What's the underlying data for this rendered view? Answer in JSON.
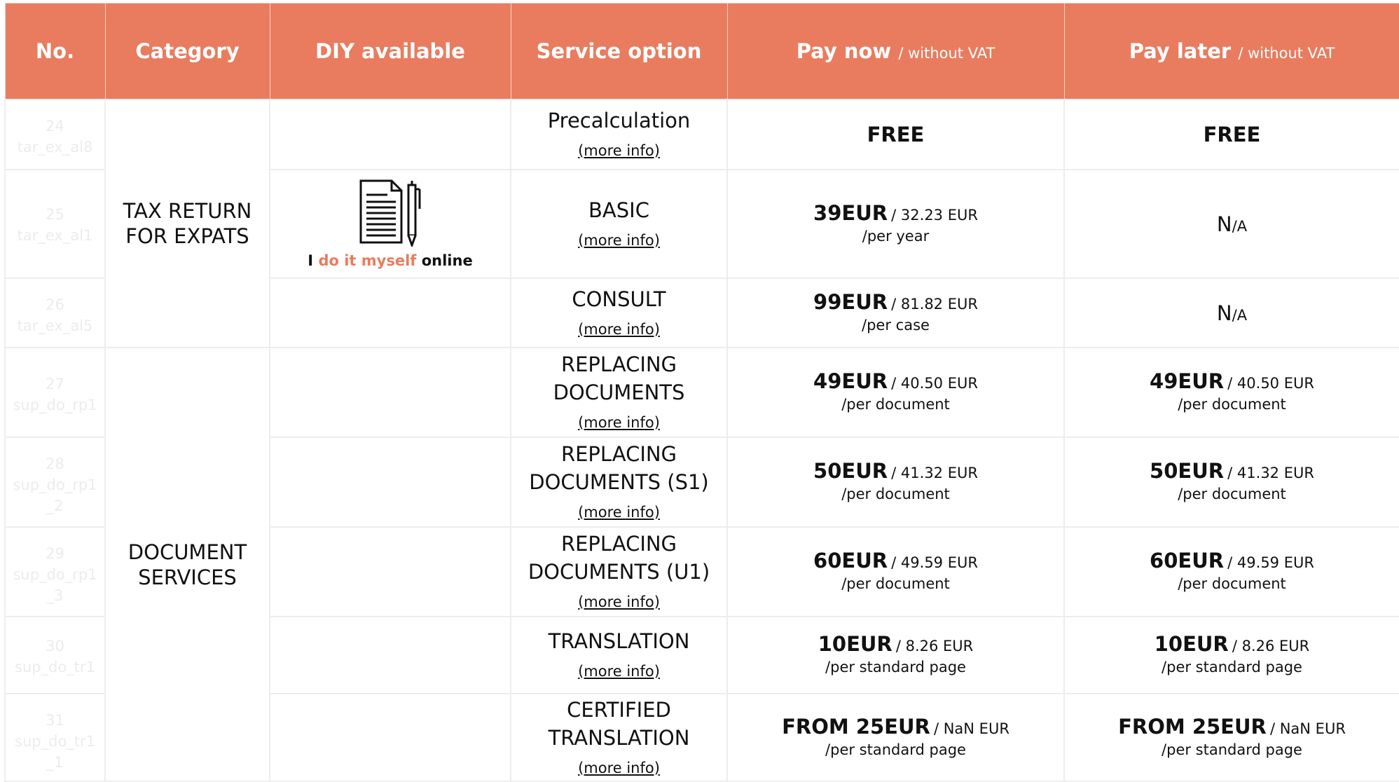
{
  "colors": {
    "header_bg": "#e97c5f",
    "accent": "#e97c5f",
    "border": "#ededed"
  },
  "header": {
    "no": "No.",
    "category": "Category",
    "diy": "DIY available",
    "service": "Service option",
    "pay_now": "Pay now",
    "pay_now_sub": "/ without VAT",
    "pay_later": "Pay later",
    "pay_later_sub": "/ without VAT"
  },
  "categories": {
    "tax": [
      "TAX RETURN",
      "FOR EXPATS"
    ],
    "docs": [
      "DOCUMENT",
      "SERVICES"
    ]
  },
  "diy": {
    "icon": "document-pen-icon",
    "pre": "I",
    "accent": "do it myself",
    "post": "online"
  },
  "more_info": "(more info)",
  "rows": [
    {
      "no": "24",
      "code": [
        "tar_ex_al8"
      ],
      "service": [
        "Precalculation"
      ],
      "now": {
        "free": "FREE"
      },
      "later": {
        "free": "FREE"
      }
    },
    {
      "no": "25",
      "code": [
        "tar_ex_al1"
      ],
      "service": [
        "BASIC"
      ],
      "now": {
        "price": "39EUR",
        "vat": "/ 32.23 EUR",
        "per": "/per year"
      },
      "later": {
        "na": "N",
        "na_small": "/A"
      }
    },
    {
      "no": "26",
      "code": [
        "tar_ex_al5"
      ],
      "service": [
        "CONSULT"
      ],
      "now": {
        "price": "99EUR",
        "vat": "/ 81.82 EUR",
        "per": "/per case"
      },
      "later": {
        "na": "N",
        "na_small": "/A"
      }
    },
    {
      "no": "27",
      "code": [
        "sup_do_rp1"
      ],
      "service": [
        "REPLACING",
        "DOCUMENTS"
      ],
      "now": {
        "price": "49EUR",
        "vat": "/ 40.50 EUR",
        "per": "/per document"
      },
      "later": {
        "price": "49EUR",
        "vat": "/ 40.50 EUR",
        "per": "/per document"
      }
    },
    {
      "no": "28",
      "code": [
        "sup_do_rp1",
        "_2"
      ],
      "service": [
        "REPLACING",
        "DOCUMENTS (S1)"
      ],
      "now": {
        "price": "50EUR",
        "vat": "/ 41.32 EUR",
        "per": "/per document"
      },
      "later": {
        "price": "50EUR",
        "vat": "/ 41.32 EUR",
        "per": "/per document"
      }
    },
    {
      "no": "29",
      "code": [
        "sup_do_rp1",
        "_3"
      ],
      "service": [
        "REPLACING",
        "DOCUMENTS (U1)"
      ],
      "now": {
        "price": "60EUR",
        "vat": "/ 49.59 EUR",
        "per": "/per document"
      },
      "later": {
        "price": "60EUR",
        "vat": "/ 49.59 EUR",
        "per": "/per document"
      }
    },
    {
      "no": "30",
      "code": [
        "sup_do_tr1"
      ],
      "service": [
        "TRANSLATION"
      ],
      "now": {
        "price": "10EUR",
        "vat": "/ 8.26 EUR",
        "per": "/per standard page"
      },
      "later": {
        "price": "10EUR",
        "vat": "/ 8.26 EUR",
        "per": "/per standard page"
      }
    },
    {
      "no": "31",
      "code": [
        "sup_do_tr1",
        "_1"
      ],
      "service": [
        "CERTIFIED",
        "TRANSLATION"
      ],
      "now": {
        "price": "FROM 25EUR",
        "vat": "/ NaN EUR",
        "per": "/per standard page"
      },
      "later": {
        "price": "FROM 25EUR",
        "vat": "/ NaN EUR",
        "per": "/per standard page"
      }
    }
  ]
}
